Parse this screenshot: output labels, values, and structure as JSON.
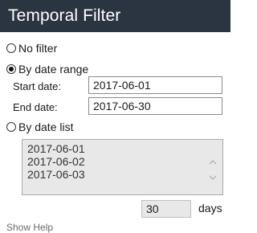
{
  "panel": {
    "title": "Temporal Filter"
  },
  "filter_options": {
    "no_filter": {
      "label": "No filter",
      "selected": false
    },
    "by_date_range": {
      "label": "By date range",
      "selected": true
    },
    "by_date_list": {
      "label": "By date list",
      "selected": false
    }
  },
  "date_range": {
    "start_label": "Start date:",
    "start_value": "2017-06-01",
    "end_label": "End date:",
    "end_value": "2017-06-30"
  },
  "date_list": {
    "items": [
      "2017-06-01",
      "2017-06-02",
      "2017-06-03"
    ]
  },
  "duration": {
    "value": "30",
    "unit_label": "days"
  },
  "help": {
    "label": "Show Help"
  }
}
